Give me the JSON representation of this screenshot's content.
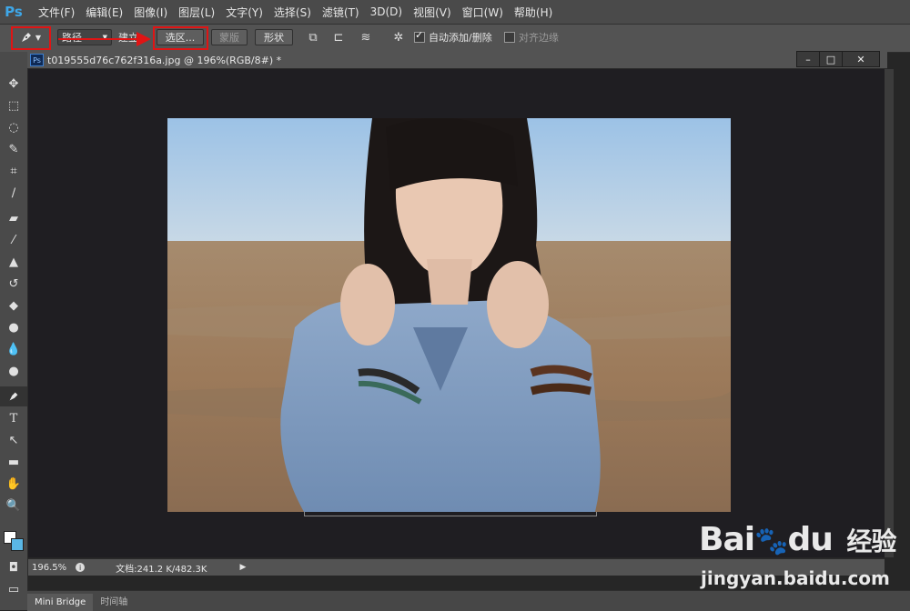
{
  "app": {
    "logo": "Ps"
  },
  "menu": [
    "文件(F)",
    "编辑(E)",
    "图像(I)",
    "图层(L)",
    "文字(Y)",
    "选择(S)",
    "滤镜(T)",
    "3D(D)",
    "视图(V)",
    "窗口(W)",
    "帮助(H)"
  ],
  "options": {
    "tool_icon": "pen-icon",
    "mode_value": "路径",
    "build_value": "建立:",
    "selection_button": "选区...",
    "mask_button": "蒙版",
    "shape_button": "形状",
    "auto_add_delete": "自动添加/删除",
    "align_edges": "对齐边缘",
    "auto_add_checked": true,
    "align_checked": false
  },
  "document": {
    "badge": "Ps",
    "title": "t019555d76c762f316a.jpg @ 196%(RGB/8#) *"
  },
  "tools": [
    "move-icon",
    "marquee-icon",
    "lasso-icon",
    "quick-select-icon",
    "crop-icon",
    "eyedropper-icon",
    "healing-brush-icon",
    "brush-icon",
    "clone-stamp-icon",
    "history-brush-icon",
    "eraser-icon",
    "paint-bucket-icon",
    "blur-icon",
    "dodge-icon",
    "pen-icon",
    "type-icon",
    "path-select-icon",
    "rectangle-icon",
    "hand-icon",
    "zoom-icon"
  ],
  "status": {
    "zoom": "196.5%",
    "doc_info": "文档:241.2 K/482.3K"
  },
  "bottom_tabs": [
    "Mini Bridge",
    "时间轴"
  ],
  "watermark": {
    "brand": "Bai",
    "brand2": "du",
    "cn": "经验",
    "url": "jingyan.baidu.com"
  },
  "colors": {
    "highlight": "#e01414",
    "accent": "#3ea7e8"
  }
}
